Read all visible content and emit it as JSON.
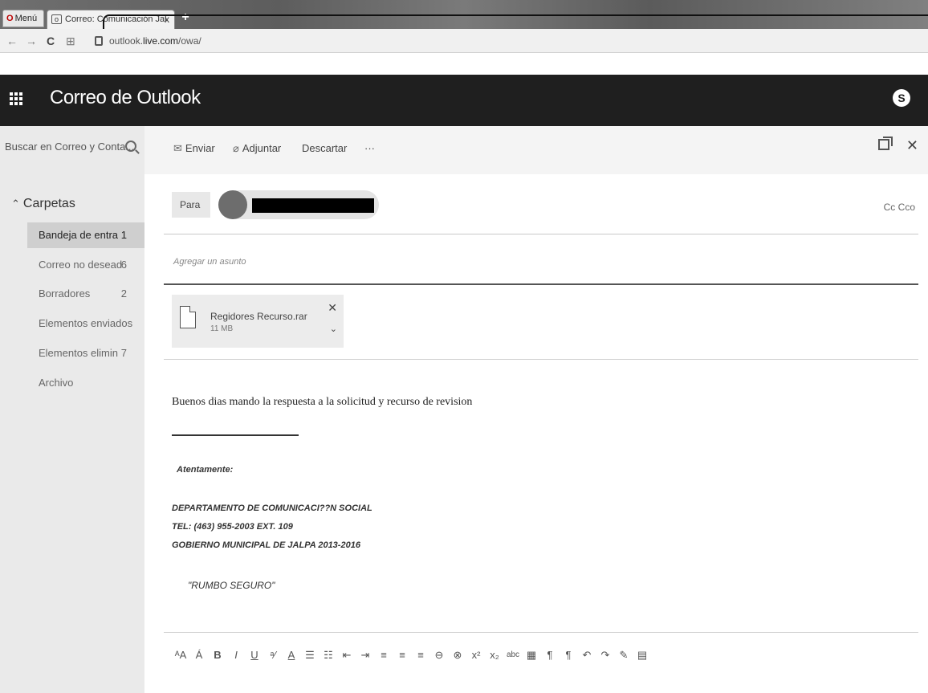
{
  "browser": {
    "menu_label": "Menú",
    "tab_title": "Correo: Comunicación Jal",
    "tab_close": "x",
    "new_tab": "+",
    "url_prefix": "outlook.",
    "url_domain": "live.com",
    "url_path": "/owa/"
  },
  "header": {
    "app_title": "Correo de Outlook",
    "skype_icon_label": "S"
  },
  "search": {
    "placeholder": "Buscar en Correo y Conta..."
  },
  "folders": {
    "heading": "Carpetas",
    "items": [
      {
        "label": "Bandeja de entra",
        "count": "1"
      },
      {
        "label": "Correo no desead",
        "count": "6"
      },
      {
        "label": "Borradores",
        "count": "2"
      },
      {
        "label": "Elementos enviados",
        "count": ""
      },
      {
        "label": "Elementos elimin",
        "count": "7"
      },
      {
        "label": "Archivo",
        "count": ""
      }
    ]
  },
  "commands": {
    "send": "Enviar",
    "attach": "Adjuntar",
    "discard": "Descartar",
    "more": "···"
  },
  "compose": {
    "to_label": "Para",
    "cc_label": "Cc",
    "bcc_label": "Cco",
    "subject_placeholder": "Agregar un asunto",
    "attachment": {
      "name": "Regidores Recurso.rar",
      "size": "11 MB"
    },
    "body": "Buenos dias mando la respuesta a la solicitud y recurso de revision",
    "signature": {
      "greeting": "Atentamente:",
      "department": "DEPARTAMENTO DE COMUNICACI??N SOCIAL",
      "phone": "TEL: (463) 955-2003 EXT. 109",
      "government": "GOBIERNO MUNICIPAL DE JALPA 2013-2016",
      "motto": "\"RUMBO SEGURO\""
    }
  },
  "toolbar_icons": [
    "font-size-icon",
    "font-shrink-icon",
    "bold-icon",
    "italic-icon",
    "underline-icon",
    "highlight-icon",
    "font-color-icon",
    "bullet-list-icon",
    "numbered-list-icon",
    "decrease-indent-icon",
    "increase-indent-icon",
    "align-left-icon",
    "align-center-icon",
    "align-right-icon",
    "insert-link-icon",
    "remove-link-icon",
    "superscript-icon",
    "subscript-icon",
    "strikethrough-icon",
    "insert-table-icon",
    "ltr-icon",
    "rtl-icon",
    "undo-icon",
    "redo-icon",
    "clear-format-icon",
    "calendar-icon"
  ]
}
